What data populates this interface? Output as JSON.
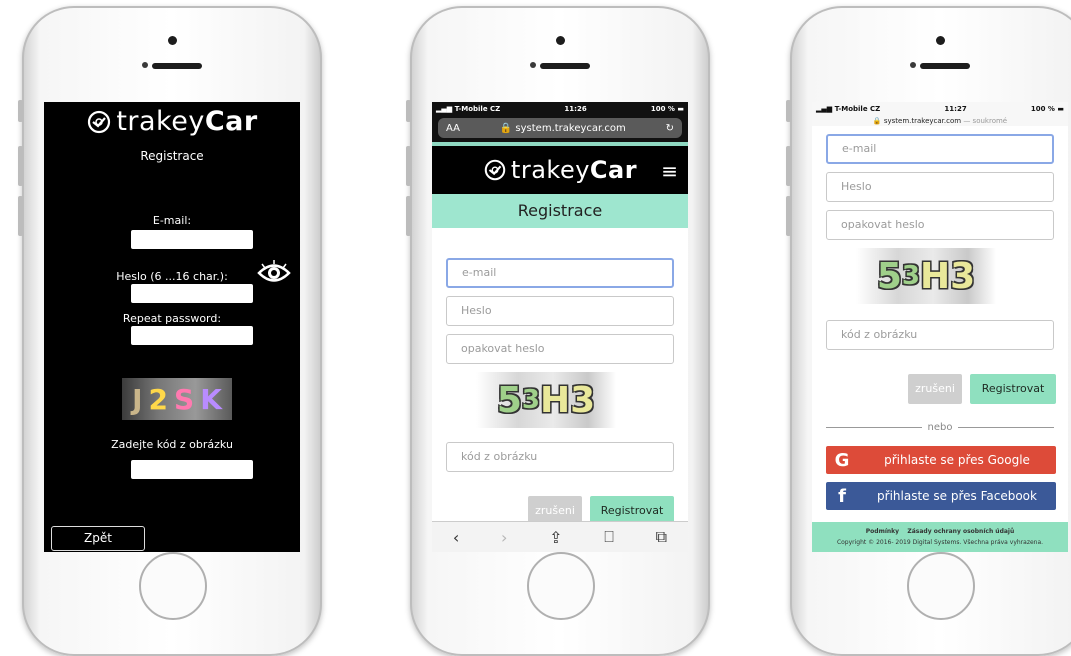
{
  "phone1": {
    "brand": {
      "prefix": "trakey",
      "suffix": "Car"
    },
    "subtitle": "Registrace",
    "email_label": "E-mail:",
    "password_label": "Heslo (6 ...16 char.):",
    "repeat_label": "Repeat password:",
    "captcha": [
      "J",
      "2",
      "S",
      "K"
    ],
    "captcha_label": "Zadejte kód z obrázku",
    "back_button": "Zpět"
  },
  "phone2": {
    "status": {
      "carrier": "T-Mobile CZ",
      "time": "11:26",
      "battery": "100 %"
    },
    "url": {
      "text_size": "AA",
      "host": "system.trakeycar.com",
      "reload": "↻"
    },
    "brand": {
      "prefix": "trakey",
      "suffix": "Car"
    },
    "menu_icon": "hamburger-icon",
    "title": "Registrace",
    "fields": {
      "email": "e-mail",
      "password": "Heslo",
      "repeat": "opakovat heslo",
      "captcha": "kód z obrázku"
    },
    "captcha": [
      "5",
      "3",
      "H",
      "3"
    ],
    "cancel": "zrušeni",
    "register": "Registrovat",
    "toolbar": [
      "back",
      "forward",
      "share",
      "bookmarks",
      "tabs"
    ]
  },
  "phone3": {
    "status": {
      "carrier": "T-Mobile CZ",
      "time": "11:27",
      "battery": "100 %"
    },
    "url": {
      "host": "system.trakeycar.com",
      "privacy": "— soukromé"
    },
    "fields": {
      "email": "e-mail",
      "password": "Heslo",
      "repeat": "opakovat heslo",
      "captcha": "kód z obrázku"
    },
    "captcha": [
      "5",
      "3",
      "H",
      "3"
    ],
    "cancel": "zrušeni",
    "register": "Registrovat",
    "divider": "nebo",
    "google": {
      "icon": "G",
      "text": "přihlaste se přes Google",
      "color": "#dd4b39"
    },
    "facebook": {
      "icon": "f",
      "text": "přihlaste se přes Facebook",
      "color": "#3b5998"
    },
    "footer": {
      "links": [
        "Podmínky",
        "Zásady ochrany osobních údajů"
      ],
      "copyright": "Copyright © 2016- 2019 Digital Systems. Všechna práva vyhrazena."
    }
  },
  "colors": {
    "mint": "#9ee6cf",
    "green_button": "#8fe0bf",
    "focus_border": "#8aa8e6"
  }
}
